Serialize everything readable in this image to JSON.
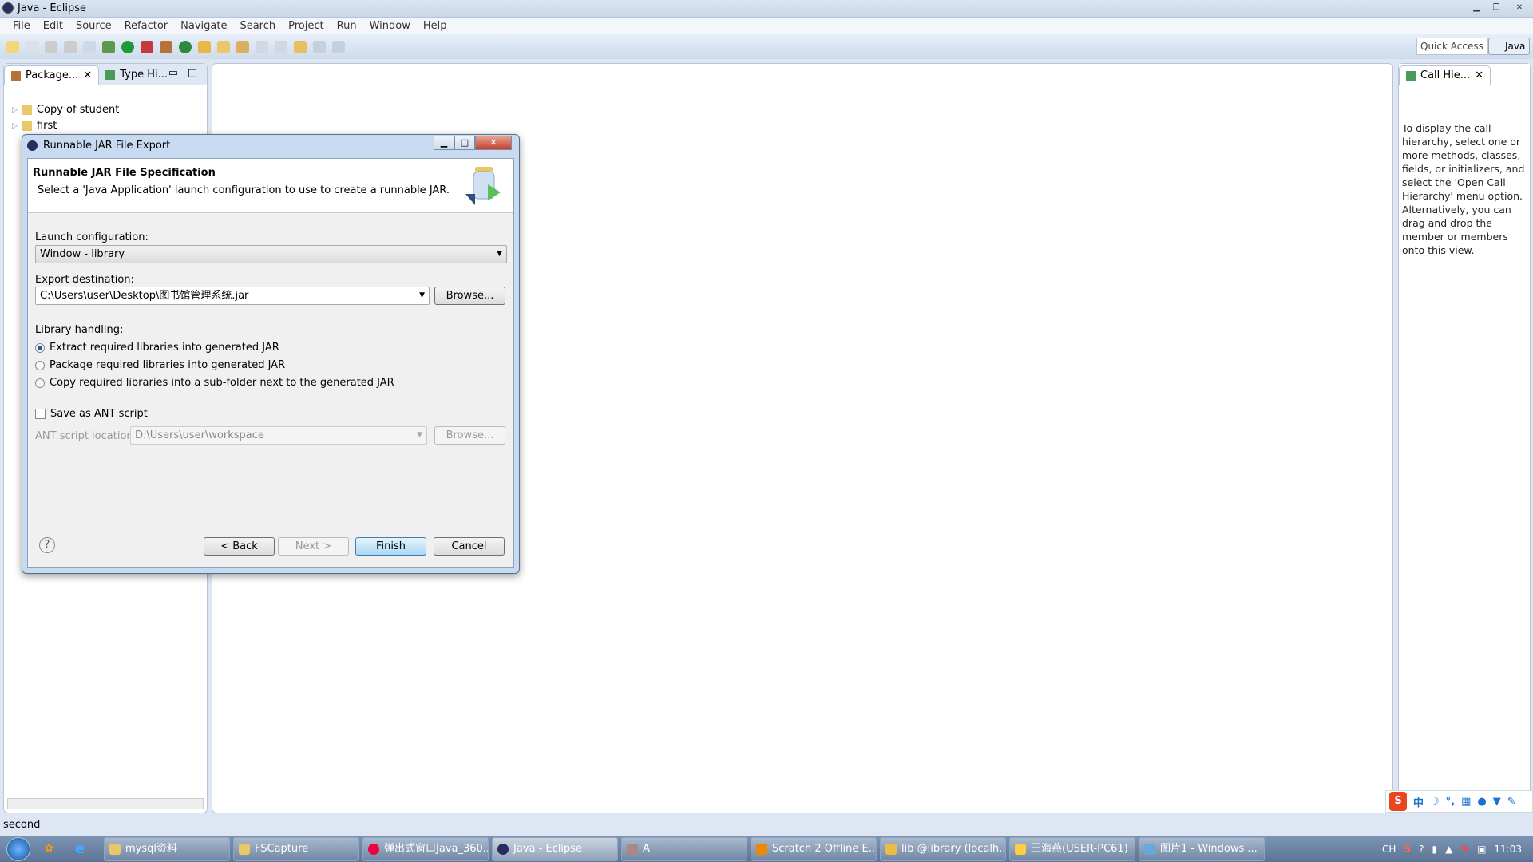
{
  "window": {
    "title": "Java - Eclipse"
  },
  "menu": [
    "File",
    "Edit",
    "Source",
    "Refactor",
    "Navigate",
    "Search",
    "Project",
    "Run",
    "Window",
    "Help"
  ],
  "toolbar": {
    "quick_access": "Quick Access",
    "perspective": "Java"
  },
  "left_panel": {
    "tabs": [
      "Package...",
      "Type Hi..."
    ],
    "tree": [
      "Copy of student",
      "first"
    ]
  },
  "right_panel": {
    "tab": "Call Hie...",
    "message": "To display the call hierarchy, select one or more methods, classes, fields, or initializers, and select the 'Open Call Hierarchy' menu option. Alternatively, you can drag and drop the member or members onto this view."
  },
  "status": {
    "text": "second"
  },
  "dialog": {
    "title": "Runnable JAR File Export",
    "heading": "Runnable JAR File Specification",
    "description": "Select a 'Java Application' launch configuration to use to create a runnable JAR.",
    "launch_label": "Launch configuration:",
    "launch_value": "Window - library",
    "export_label": "Export destination:",
    "export_value": "C:\\Users\\user\\Desktop\\图书馆管理系统.jar",
    "browse": "Browse...",
    "library_label": "Library handling:",
    "library_options": [
      {
        "label": "Extract required libraries into generated JAR",
        "selected": true
      },
      {
        "label": "Package required libraries into generated JAR",
        "selected": false
      },
      {
        "label": "Copy required libraries into a sub-folder next to the generated JAR",
        "selected": false
      }
    ],
    "save_ant": {
      "label": "Save as ANT script",
      "checked": false
    },
    "ant_label": "ANT script location:",
    "ant_value": "D:\\Users\\user\\workspace",
    "buttons": {
      "back": "< Back",
      "next": "Next >",
      "finish": "Finish",
      "cancel": "Cancel"
    }
  },
  "taskbar": {
    "items": [
      "mysql资料",
      "FSCapture",
      "弹出式窗口Java_360...",
      "Java - Eclipse",
      "A",
      "Scratch 2 Offline E...",
      "lib @library (localh...",
      "王海燕(USER-PC61)",
      "图片1 - Windows ..."
    ],
    "active": "Java - Eclipse",
    "lang": "CH",
    "clock": "11:03"
  },
  "ime": {
    "mode": "中"
  }
}
